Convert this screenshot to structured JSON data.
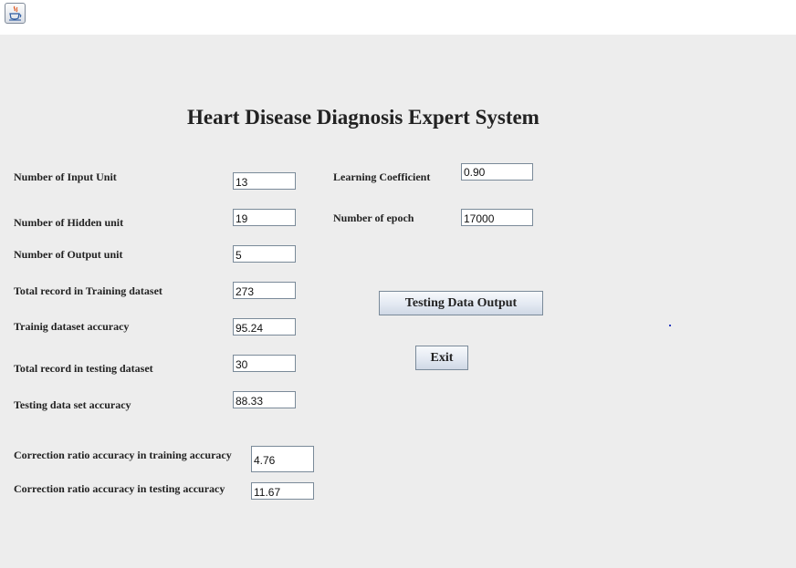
{
  "window": {
    "icon": "java-coffee-icon"
  },
  "title": "Heart Disease Diagnosis Expert System",
  "fields": {
    "input_units": {
      "label": "Number of Input Unit",
      "value": "13"
    },
    "hidden_units": {
      "label": "Number of Hidden unit",
      "value": "19"
    },
    "output_units": {
      "label": "Number of Output unit",
      "value": "5"
    },
    "training_total": {
      "label": "Total record in Training dataset",
      "value": "273"
    },
    "training_accuracy": {
      "label": "Trainig dataset accuracy",
      "value": "95.24"
    },
    "testing_total": {
      "label": "Total  record in testing dataset",
      "value": "30"
    },
    "testing_accuracy": {
      "label": "Testing data set accuracy",
      "value": "88.33"
    },
    "correction_training": {
      "label": "Correction ratio accuracy in training accuracy",
      "value": "4.76"
    },
    "correction_testing": {
      "label": "Correction ratio accuracy in testing accuracy",
      "value": "11.67"
    },
    "learning_coefficient": {
      "label": "Learning Coefficient",
      "value": "0.90"
    },
    "epochs": {
      "label": "Number of epoch",
      "value": "17000"
    }
  },
  "buttons": {
    "testing_output": "Testing Data Output",
    "exit": "Exit"
  }
}
